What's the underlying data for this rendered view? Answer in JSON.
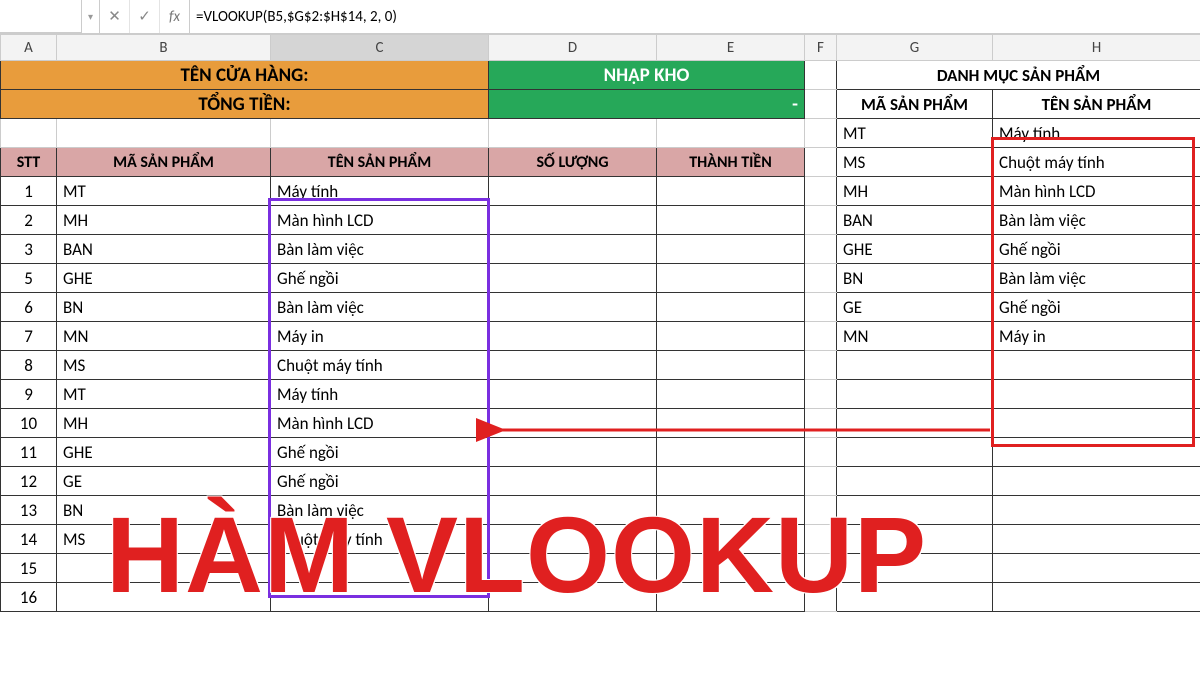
{
  "formula_bar": {
    "namebox": "",
    "fx_label": "fx",
    "formula": "=VLOOKUP(B5,$G$2:$H$14, 2, 0)"
  },
  "columns": [
    "A",
    "B",
    "C",
    "D",
    "E",
    "F",
    "G",
    "H"
  ],
  "headers": {
    "store_name": "TÊN CỬA HÀNG:",
    "total": "TỔNG TIỀN:",
    "import": "NHẬP KHO",
    "import_total_value": "-",
    "catalog": "DANH MỤC SẢN PHẨM",
    "ma_sp": "MÃ SẢN PHẨM",
    "ten_sp": "TÊN SẢN PHẨM",
    "stt": "STT",
    "soluong": "SỐ LƯỢNG",
    "thanhtien": "THÀNH TIỀN"
  },
  "left_rows": [
    {
      "stt": "1",
      "ma": "MT",
      "ten": "Máy tính"
    },
    {
      "stt": "2",
      "ma": "MH",
      "ten": "Màn hình LCD"
    },
    {
      "stt": "3",
      "ma": "BAN",
      "ten": "Bàn làm việc"
    },
    {
      "stt": "5",
      "ma": "GHE",
      "ten": "Ghế ngồi"
    },
    {
      "stt": "6",
      "ma": "BN",
      "ten": "Bàn làm việc"
    },
    {
      "stt": "7",
      "ma": "MN",
      "ten": "Máy in"
    },
    {
      "stt": "8",
      "ma": "MS",
      "ten": "Chuột máy tính"
    },
    {
      "stt": "9",
      "ma": "MT",
      "ten": "Máy tính"
    },
    {
      "stt": "10",
      "ma": "MH",
      "ten": "Màn hình LCD"
    },
    {
      "stt": "11",
      "ma": "GHE",
      "ten": "Ghế ngồi"
    },
    {
      "stt": "12",
      "ma": "GE",
      "ten": "Ghế ngồi"
    },
    {
      "stt": "13",
      "ma": "BN",
      "ten": "Bàn làm việc"
    },
    {
      "stt": "14",
      "ma": "MS",
      "ten": "Chuột máy tính"
    },
    {
      "stt": "15",
      "ma": "",
      "ten": ""
    },
    {
      "stt": "16",
      "ma": "",
      "ten": ""
    }
  ],
  "catalog_rows": [
    {
      "ma": "MT",
      "ten": "Máy tính"
    },
    {
      "ma": "MS",
      "ten": "Chuột máy tính"
    },
    {
      "ma": "MH",
      "ten": "Màn hình LCD"
    },
    {
      "ma": "BAN",
      "ten": "Bàn làm việc"
    },
    {
      "ma": "GHE",
      "ten": "Ghế ngồi"
    },
    {
      "ma": "BN",
      "ten": "Bàn làm việc"
    },
    {
      "ma": "GE",
      "ten": "Ghế ngồi"
    },
    {
      "ma": "MN",
      "ten": "Máy in"
    }
  ],
  "annotation": {
    "title": "HÀM VLOOKUP"
  }
}
